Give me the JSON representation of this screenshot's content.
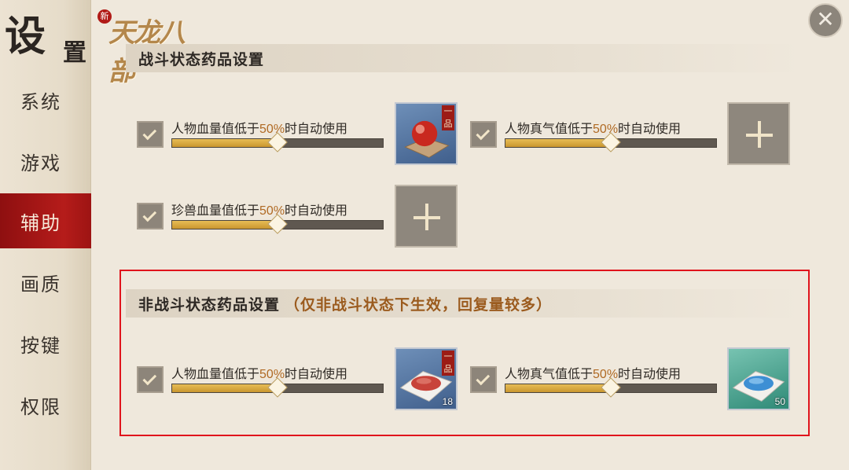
{
  "sidebar": {
    "title_big": "设",
    "title_small": "置",
    "items": [
      {
        "label": "系统"
      },
      {
        "label": "游戏"
      },
      {
        "label": "辅助"
      },
      {
        "label": "画质"
      },
      {
        "label": "按键"
      },
      {
        "label": "权限"
      }
    ],
    "active_index": 2
  },
  "logo": {
    "seal": "新",
    "text": "天龙八部"
  },
  "close_icon": "close-icon",
  "combat": {
    "header": "战斗状态药品设置",
    "settings": [
      {
        "label_prefix": "人物血量值低于",
        "percent": "50%",
        "label_suffix": "时自动使用",
        "value": 0.5,
        "checked": true
      },
      {
        "label_prefix": "人物真气值低于",
        "percent": "50%",
        "label_suffix": "时自动使用",
        "value": 0.5,
        "checked": true
      },
      {
        "label_prefix": "珍兽血量值低于",
        "percent": "50%",
        "label_suffix": "时自动使用",
        "value": 0.5,
        "checked": true
      }
    ],
    "slots": [
      {
        "type": "item",
        "icon": "red-pill-icon",
        "grade": "一品"
      },
      {
        "type": "empty",
        "icon": "plus-icon"
      },
      {
        "type": "empty",
        "icon": "plus-icon"
      }
    ]
  },
  "noncombat": {
    "header": "非战斗状态药品设置",
    "note": "（仅非战斗状态下生效，回复量较多）",
    "settings": [
      {
        "label_prefix": "人物血量值低于",
        "percent": "50%",
        "label_suffix": "时自动使用",
        "value": 0.5,
        "checked": true
      },
      {
        "label_prefix": "人物真气值低于",
        "percent": "50%",
        "label_suffix": "时自动使用",
        "value": 0.5,
        "checked": true
      }
    ],
    "slots": [
      {
        "type": "item",
        "icon": "red-powder-icon",
        "grade": "一品",
        "qty": "18"
      },
      {
        "type": "item",
        "icon": "blue-powder-icon",
        "qty": "50"
      }
    ]
  },
  "colors": {
    "accent_red": "#b51c1a",
    "gold": "#c9962f",
    "highlight": "#e0141c"
  }
}
